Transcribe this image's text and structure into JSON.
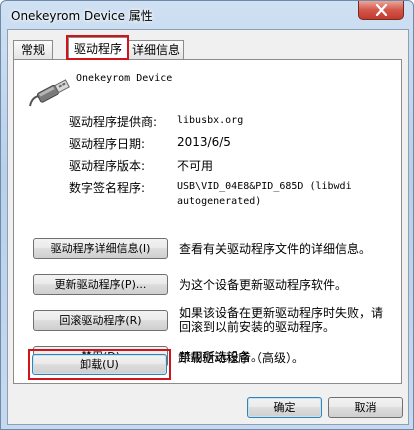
{
  "window": {
    "title": "Onekeyrom Device 属性"
  },
  "tabs": [
    {
      "label": "常规"
    },
    {
      "label": "驱动程序"
    },
    {
      "label": "详细信息"
    }
  ],
  "device": {
    "name": "Onekeyrom Device"
  },
  "properties": [
    {
      "label": "驱动程序提供商:",
      "value": "libusbx.org"
    },
    {
      "label": "驱动程序日期:",
      "value": "2013/6/5"
    },
    {
      "label": "驱动程序版本:",
      "value": "不可用"
    },
    {
      "label": "数字签名程序:",
      "value": "USB\\VID_04E8&PID_685D (libwdi",
      "value2": "autogenerated)"
    }
  ],
  "actions": [
    {
      "button": "驱动程序详细信息(I)",
      "desc": "查看有关驱动程序文件的详细信息。"
    },
    {
      "button": "更新驱动程序(P)...",
      "desc": "为这个设备更新驱动程序软件。"
    },
    {
      "button": "回滚驱动程序(R)",
      "desc": "如果该设备在更新驱动程序时失败，请",
      "desc2": "回滚到以前安装的驱动程序。"
    },
    {
      "button": "禁用(D)",
      "desc": "禁用所选设备。"
    },
    {
      "button": "卸载(U)",
      "desc": "卸载驱动程序（高级）。"
    }
  ],
  "dialog_buttons": {
    "ok": "确定",
    "cancel": "取消"
  },
  "colors": {
    "highlight": "#d0151a",
    "close_button": "#c13a2e"
  }
}
